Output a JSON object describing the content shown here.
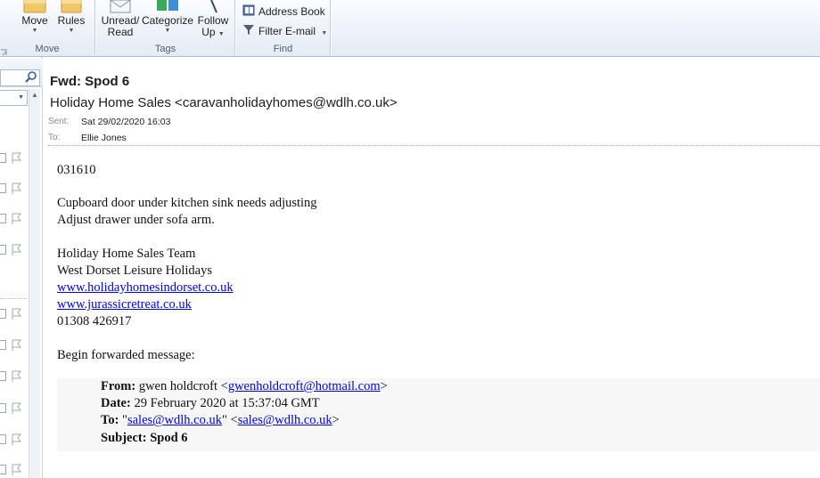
{
  "ribbon": {
    "move_group": {
      "label": "Move",
      "buttons": [
        {
          "label": "Move",
          "icon": "folder-move-icon"
        },
        {
          "label": "Rules",
          "icon": "rules-icon"
        }
      ]
    },
    "tags_group": {
      "label": "Tags",
      "buttons": [
        {
          "label_line1": "Unread/",
          "label_line2": "Read",
          "icon": "envelope-icon"
        },
        {
          "label": "Categorize",
          "icon": "categorize-icon"
        },
        {
          "label_line1": "Follow",
          "label_line2": "Up",
          "icon": "flag-icon"
        }
      ]
    },
    "find_group": {
      "label": "Find",
      "buttons": [
        {
          "label": "Address Book",
          "icon": "address-book-icon"
        },
        {
          "label": "Filter E-mail",
          "icon": "filter-icon"
        }
      ]
    }
  },
  "message": {
    "subject": "Fwd: Spod 6",
    "from": "Holiday Home Sales <caravanholidayhomes@wdlh.co.uk>",
    "sent_label": "Sent:",
    "sent_value": "Sat 29/02/2020 16:03",
    "to_label": "To:",
    "to_value": "Ellie Jones",
    "body": {
      "ref": "031610",
      "line1": "Cupboard door under kitchen sink needs adjusting",
      "line2": "Adjust drawer under sofa arm.",
      "sig_team": "Holiday Home Sales Team",
      "sig_company": "West Dorset Leisure Holidays",
      "sig_link1": "www.holidayhomesindorset.co.uk",
      "sig_link2": "www.jurassicretreat.co.uk",
      "sig_phone": "01308 426917",
      "fwd_intro": "Begin forwarded message:"
    },
    "forwarded": {
      "from_label": "From:",
      "from_name": "gwen holdcroft <",
      "from_email": "gwenholdcroft@hotmail.com",
      "from_close": ">",
      "date_label": "Date:",
      "date_value": "29 February 2020 at 15:37:04 GMT",
      "to_label": "To:",
      "to_quote_open": "\"",
      "to_name_link": "sales@wdlh.co.uk",
      "to_mid": "\" <",
      "to_email_link": "sales@wdlh.co.uk",
      "to_close": ">",
      "subject_label": "Subject:",
      "subject_value": "Spod 6"
    }
  },
  "colors": {
    "ribbon_bg": "#e4ebf5",
    "link": "#0000ee",
    "meta_label": "#8a8a8a"
  }
}
